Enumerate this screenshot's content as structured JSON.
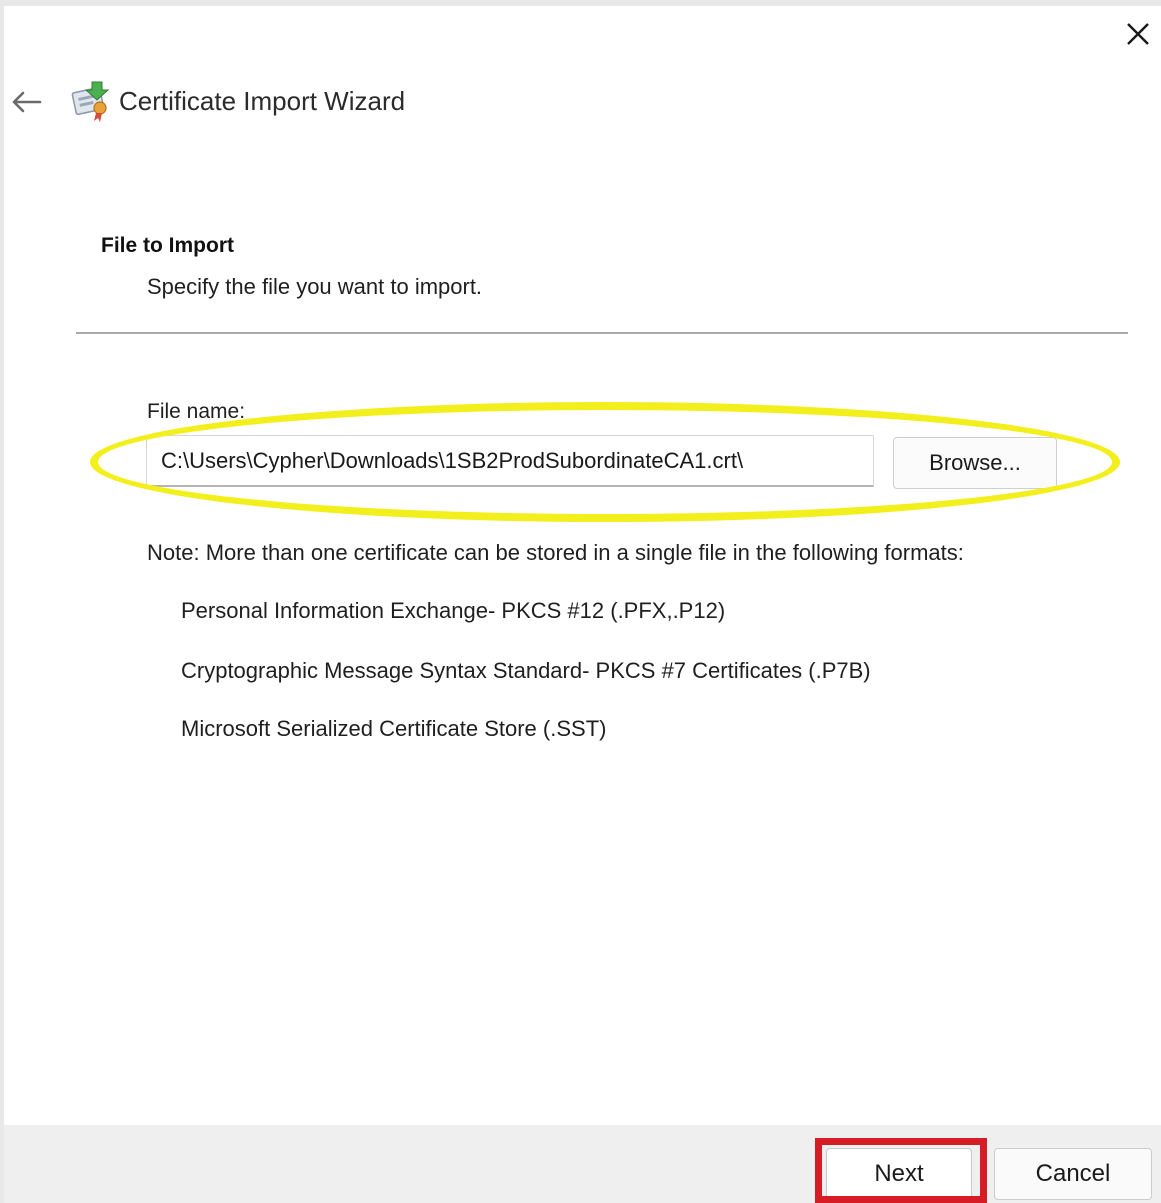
{
  "window": {
    "title": "Certificate Import Wizard",
    "close_icon": "close-icon",
    "back_icon": "back-arrow-icon",
    "app_icon": "certificate-wizard-icon"
  },
  "section": {
    "title": "File to Import",
    "subtitle": "Specify the file you want to import."
  },
  "file": {
    "label": "File name:",
    "value": "C:\\Users\\Cypher\\Downloads\\1SB2ProdSubordinateCA1.crt\\",
    "browse_label": "Browse..."
  },
  "note": {
    "text": "Note:  More than one certificate can be stored in a single file in the following formats:",
    "formats": [
      "Personal Information Exchange- PKCS #12 (.PFX,.P12)",
      "Cryptographic Message Syntax Standard- PKCS #7 Certificates (.P7B)",
      "Microsoft Serialized Certificate Store (.SST)"
    ]
  },
  "footer": {
    "next_label": "Next",
    "cancel_label": "Cancel"
  },
  "colors": {
    "highlight_yellow": "#f3ef1c",
    "highlight_red": "#d61c25"
  }
}
